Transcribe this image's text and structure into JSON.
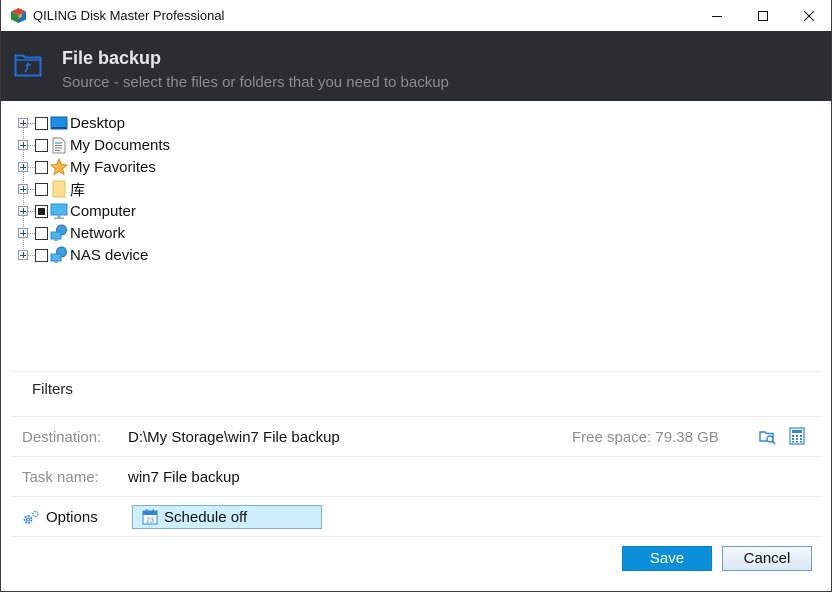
{
  "window": {
    "title": "QILING Disk Master Professional",
    "controls": {
      "minimize": "minimize",
      "maximize": "maximize",
      "close": "close"
    }
  },
  "header": {
    "title": "File backup",
    "subtitle": "Source - select the files or folders that you need to backup",
    "icon": "folder-backup-icon",
    "accent": "#1e6fe0"
  },
  "tree": {
    "items": [
      {
        "label": "Desktop",
        "icon": "desktop-icon",
        "checked": "unchecked"
      },
      {
        "label": "My Documents",
        "icon": "document-icon",
        "checked": "unchecked"
      },
      {
        "label": "My Favorites",
        "icon": "star-icon",
        "checked": "unchecked"
      },
      {
        "label": "库",
        "icon": "library-folder-icon",
        "checked": "unchecked"
      },
      {
        "label": "Computer",
        "icon": "computer-icon",
        "checked": "partial"
      },
      {
        "label": "Network",
        "icon": "network-icon",
        "checked": "unchecked"
      },
      {
        "label": "NAS device",
        "icon": "nas-icon",
        "checked": "unchecked"
      }
    ]
  },
  "filters": {
    "label": "Filters"
  },
  "destination": {
    "label": "Destination:",
    "value": "D:\\My Storage\\win7 File backup",
    "free_space": "Free space: 79.38 GB",
    "browse_icon": "browse-folder-icon",
    "calc_icon": "calculator-icon"
  },
  "task": {
    "label": "Task name:",
    "value": "win7 File backup"
  },
  "options": {
    "label": "Options",
    "icon": "gears-icon"
  },
  "schedule": {
    "label": "Schedule off",
    "icon": "calendar-icon"
  },
  "footer": {
    "save": "Save",
    "cancel": "Cancel"
  },
  "colors": {
    "save_bg": "#0c8fdb",
    "schedule_bg": "#cdeffc",
    "header_bg": "#2b2d33"
  }
}
